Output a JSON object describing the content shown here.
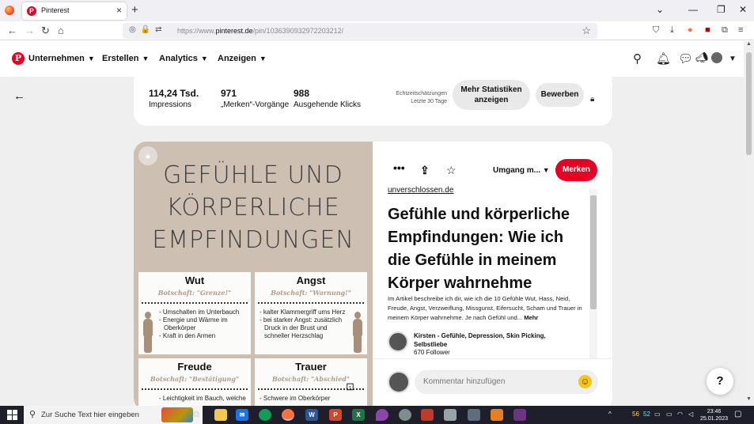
{
  "browser": {
    "tab_title": "Pinterest",
    "url_prefix": "https://www.",
    "url_domain": "pinterest.de",
    "url_path": "/pin/1036390932972203212/"
  },
  "header": {
    "logo_glyph": "P",
    "nav": [
      {
        "label": "Unternehmen"
      },
      {
        "label": "Erstellen"
      },
      {
        "label": "Analytics"
      },
      {
        "label": "Anzeigen"
      }
    ]
  },
  "stats": {
    "impressions_value": "114,24 Tsd.",
    "impressions_label": "Impressions",
    "saves_value": "971",
    "saves_label": "„Merken“-Vorgänge",
    "clicks_value": "988",
    "clicks_label": "Ausgehende Klicks",
    "estimate_line1": "Echtzeitschätzungen",
    "estimate_line2": "Letzte 30 Tage",
    "more_stats_label": "Mehr Statistiken anzeigen",
    "promote_label": "Bewerben"
  },
  "pin_image": {
    "title_lines": [
      "GEFÜHLE UND",
      "KÖRPERLICHE",
      "EMPFINDUNGEN"
    ],
    "emotions": [
      {
        "name": "Wut",
        "message": "Botschaft: \"Grenze!\"",
        "items": [
          "- Umschalten im Unterbauch",
          "- Energie und Wärme im",
          "  Oberkörper",
          "- Kraft in den Armen"
        ]
      },
      {
        "name": "Angst",
        "message": "Botschaft: \"Warnung!\"",
        "items": [
          "- kalter Klammergriff ums Herz",
          "- bei starker Angst: zusätzlich",
          "  Druck in der Brust und",
          "  schneller Herzschlag"
        ]
      },
      {
        "name": "Freude",
        "message": "Botschaft: \"Bestätigung\"",
        "items": [
          "- Leichtigkeit im Bauch, welche"
        ]
      },
      {
        "name": "Trauer",
        "message": "Botschaft: \"Abschied\"",
        "items": [
          "- Schwere im Oberkörper"
        ]
      }
    ]
  },
  "pin": {
    "board_label": "Umgang m...",
    "save_label": "Merken",
    "domain": "unverschlossen.de",
    "title": "Gefühle und körperliche Empfindungen: Wie ich die Gefühle in meinem Körper wahrnehme",
    "description": "Im Artikel beschreibe ich dir, wie ich die 10 Gefühle Wut, Hass, Neid, Freude, Angst, Verzweiflung, Missgunst, Eifersucht, Scham und Trauer in meinem Körper wahrnehme. Je nach Gefühl und...",
    "more_label": "Mehr",
    "author_name": "Kirsten - Gefühle, Depression, Skin Picking, Selbstliebe",
    "author_followers": "670 Follower",
    "comment_placeholder": "Kommentar hinzufügen"
  },
  "help_label": "?",
  "taskbar": {
    "search_placeholder": "Zur Suche Text hier eingeben",
    "tray_left": "56",
    "tray_mid": "52",
    "time": "23:46",
    "date": "25.01.2023"
  },
  "colors": {
    "brand_red": "#e60023",
    "pin_bg": "#cdbfb2",
    "message_tan": "#b39c86"
  }
}
